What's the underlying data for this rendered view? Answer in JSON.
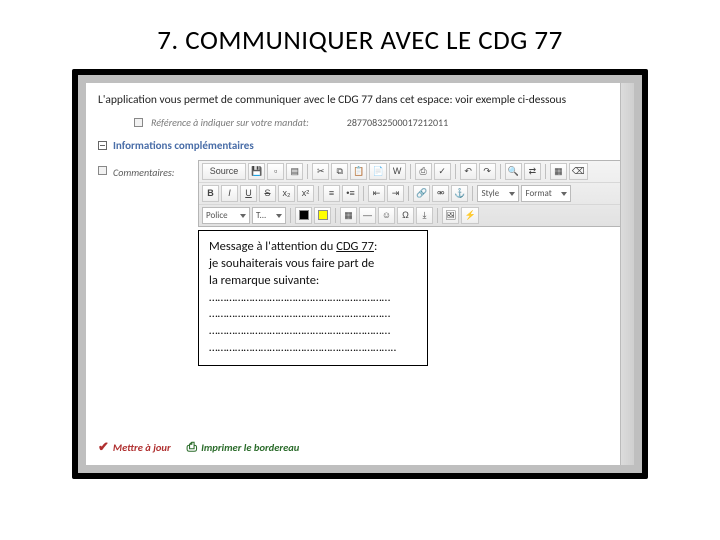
{
  "title": "7. COMMUNIQUER AVEC LE CDG 77",
  "intro": "L'application vous permet de communiquer avec le CDG 77 dans cet espace: voir exemple ci-dessous",
  "reference": {
    "label": "Référence à indiquer sur votre mandat:",
    "value": "28770832500017212011"
  },
  "section_info": "Informations complémentaires",
  "comments_label": "Commentaires:",
  "toolbar": {
    "row1": {
      "source": "Source",
      "style_label": "Style",
      "format_label": "Format"
    },
    "row3": {
      "police_label": "Police",
      "size_label": "T..."
    }
  },
  "message": {
    "line1_prefix": "Message à l'attention du ",
    "line1_under": "CDG 77",
    "line1_suffix": ":",
    "line2": "je souhaiterais vous faire part de",
    "line3": "la remarque suivante:",
    "dots1": "………………………………………………………",
    "dots2": "………………………………………………………",
    "dots3": "………………………………………………………",
    "dots4": "……………………………………………………….."
  },
  "actions": {
    "update": "Mettre à jour",
    "print": "Imprimer le bordereau"
  }
}
